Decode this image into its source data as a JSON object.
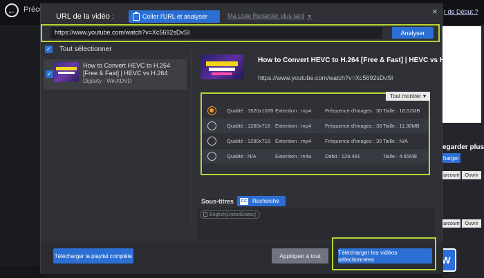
{
  "background": {
    "prev_label": "Précé",
    "right_link": "r de Début ?",
    "right_title": "egarder plus t",
    "right_button": "harger",
    "buttons_row1": [
      "arcourir",
      "Ouvrir"
    ],
    "buttons_row2": [
      "arcourir",
      "Ouvrir"
    ],
    "logo_letter": "W"
  },
  "dialog": {
    "url_label": "URL de la vidéo :",
    "paste_button": "Coller l'URL et analyser",
    "watch_later": "Ma Liste Regarder plus tard",
    "close": "×",
    "url_value": "https://www.youtube.com/watch?v=Xc5692sDvSI",
    "analyze_button": "Analyser"
  },
  "left": {
    "select_all": "Tout sélectionner",
    "item": {
      "title": "How to Convert HEVC to H.264 [Free & Fast] | HEVC vs H.264",
      "subtitle": "Digiarty - WinXDVD"
    }
  },
  "details": {
    "title": "How to Convert HEVC to H.264 [Free & Fast] | HEVC vs H.264",
    "url": "https://www.youtube.com/watch?v=Xc5692sDvSI",
    "show_all": "Tout montrer",
    "formats": [
      {
        "quality": "Qualité : 1920x1078",
        "ext": "Extention : mp4",
        "rate": "Fréquence d'images : 30",
        "size": "Taille : 18.52MB",
        "selected": true
      },
      {
        "quality": "Qualité : 1280x718",
        "ext": "Extention : mp4",
        "rate": "Fréquence d'images : 30",
        "size": "Taille : 11.30MB",
        "selected": false
      },
      {
        "quality": "Qualité : 1280x718",
        "ext": "Extention : mp4",
        "rate": "Fréquence d'images : 30",
        "size": "Taille : N/A",
        "selected": false
      },
      {
        "quality": "Qualité : N/A",
        "ext": "Extention : m4a",
        "rate": "Débit : 129.491",
        "size": "Taille : 4.65MB",
        "selected": false
      }
    ],
    "subs_label": "Sous-titres",
    "search_button": "Recherche",
    "subtitle_option": "English(UnitedStates)"
  },
  "footer": {
    "playlist_button": "Télécharger la playlist complète",
    "apply_button": "Appliquer à tout",
    "download_button": "Télécharger les vidéos sélectionnées"
  }
}
